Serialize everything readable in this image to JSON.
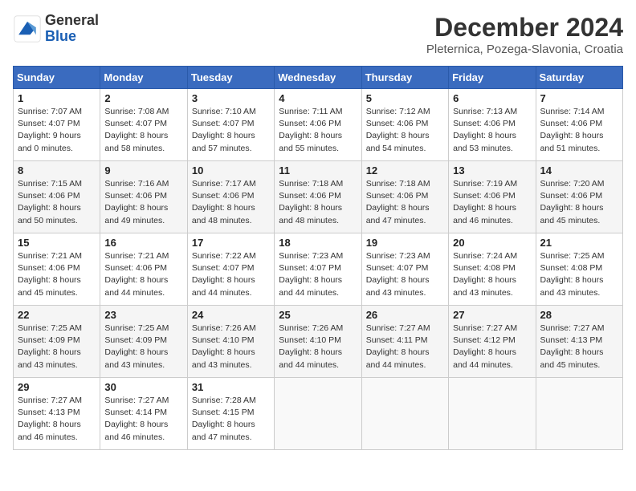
{
  "header": {
    "logo_general": "General",
    "logo_blue": "Blue",
    "title": "December 2024",
    "location": "Pleternica, Pozega-Slavonia, Croatia"
  },
  "days_of_week": [
    "Sunday",
    "Monday",
    "Tuesday",
    "Wednesday",
    "Thursday",
    "Friday",
    "Saturday"
  ],
  "weeks": [
    [
      {
        "day": 1,
        "sunrise": "Sunrise: 7:07 AM",
        "sunset": "Sunset: 4:07 PM",
        "daylight": "Daylight: 9 hours and 0 minutes."
      },
      {
        "day": 2,
        "sunrise": "Sunrise: 7:08 AM",
        "sunset": "Sunset: 4:07 PM",
        "daylight": "Daylight: 8 hours and 58 minutes."
      },
      {
        "day": 3,
        "sunrise": "Sunrise: 7:10 AM",
        "sunset": "Sunset: 4:07 PM",
        "daylight": "Daylight: 8 hours and 57 minutes."
      },
      {
        "day": 4,
        "sunrise": "Sunrise: 7:11 AM",
        "sunset": "Sunset: 4:06 PM",
        "daylight": "Daylight: 8 hours and 55 minutes."
      },
      {
        "day": 5,
        "sunrise": "Sunrise: 7:12 AM",
        "sunset": "Sunset: 4:06 PM",
        "daylight": "Daylight: 8 hours and 54 minutes."
      },
      {
        "day": 6,
        "sunrise": "Sunrise: 7:13 AM",
        "sunset": "Sunset: 4:06 PM",
        "daylight": "Daylight: 8 hours and 53 minutes."
      },
      {
        "day": 7,
        "sunrise": "Sunrise: 7:14 AM",
        "sunset": "Sunset: 4:06 PM",
        "daylight": "Daylight: 8 hours and 51 minutes."
      }
    ],
    [
      {
        "day": 8,
        "sunrise": "Sunrise: 7:15 AM",
        "sunset": "Sunset: 4:06 PM",
        "daylight": "Daylight: 8 hours and 50 minutes."
      },
      {
        "day": 9,
        "sunrise": "Sunrise: 7:16 AM",
        "sunset": "Sunset: 4:06 PM",
        "daylight": "Daylight: 8 hours and 49 minutes."
      },
      {
        "day": 10,
        "sunrise": "Sunrise: 7:17 AM",
        "sunset": "Sunset: 4:06 PM",
        "daylight": "Daylight: 8 hours and 48 minutes."
      },
      {
        "day": 11,
        "sunrise": "Sunrise: 7:18 AM",
        "sunset": "Sunset: 4:06 PM",
        "daylight": "Daylight: 8 hours and 48 minutes."
      },
      {
        "day": 12,
        "sunrise": "Sunrise: 7:18 AM",
        "sunset": "Sunset: 4:06 PM",
        "daylight": "Daylight: 8 hours and 47 minutes."
      },
      {
        "day": 13,
        "sunrise": "Sunrise: 7:19 AM",
        "sunset": "Sunset: 4:06 PM",
        "daylight": "Daylight: 8 hours and 46 minutes."
      },
      {
        "day": 14,
        "sunrise": "Sunrise: 7:20 AM",
        "sunset": "Sunset: 4:06 PM",
        "daylight": "Daylight: 8 hours and 45 minutes."
      }
    ],
    [
      {
        "day": 15,
        "sunrise": "Sunrise: 7:21 AM",
        "sunset": "Sunset: 4:06 PM",
        "daylight": "Daylight: 8 hours and 45 minutes."
      },
      {
        "day": 16,
        "sunrise": "Sunrise: 7:21 AM",
        "sunset": "Sunset: 4:06 PM",
        "daylight": "Daylight: 8 hours and 44 minutes."
      },
      {
        "day": 17,
        "sunrise": "Sunrise: 7:22 AM",
        "sunset": "Sunset: 4:07 PM",
        "daylight": "Daylight: 8 hours and 44 minutes."
      },
      {
        "day": 18,
        "sunrise": "Sunrise: 7:23 AM",
        "sunset": "Sunset: 4:07 PM",
        "daylight": "Daylight: 8 hours and 44 minutes."
      },
      {
        "day": 19,
        "sunrise": "Sunrise: 7:23 AM",
        "sunset": "Sunset: 4:07 PM",
        "daylight": "Daylight: 8 hours and 43 minutes."
      },
      {
        "day": 20,
        "sunrise": "Sunrise: 7:24 AM",
        "sunset": "Sunset: 4:08 PM",
        "daylight": "Daylight: 8 hours and 43 minutes."
      },
      {
        "day": 21,
        "sunrise": "Sunrise: 7:25 AM",
        "sunset": "Sunset: 4:08 PM",
        "daylight": "Daylight: 8 hours and 43 minutes."
      }
    ],
    [
      {
        "day": 22,
        "sunrise": "Sunrise: 7:25 AM",
        "sunset": "Sunset: 4:09 PM",
        "daylight": "Daylight: 8 hours and 43 minutes."
      },
      {
        "day": 23,
        "sunrise": "Sunrise: 7:25 AM",
        "sunset": "Sunset: 4:09 PM",
        "daylight": "Daylight: 8 hours and 43 minutes."
      },
      {
        "day": 24,
        "sunrise": "Sunrise: 7:26 AM",
        "sunset": "Sunset: 4:10 PM",
        "daylight": "Daylight: 8 hours and 43 minutes."
      },
      {
        "day": 25,
        "sunrise": "Sunrise: 7:26 AM",
        "sunset": "Sunset: 4:10 PM",
        "daylight": "Daylight: 8 hours and 44 minutes."
      },
      {
        "day": 26,
        "sunrise": "Sunrise: 7:27 AM",
        "sunset": "Sunset: 4:11 PM",
        "daylight": "Daylight: 8 hours and 44 minutes."
      },
      {
        "day": 27,
        "sunrise": "Sunrise: 7:27 AM",
        "sunset": "Sunset: 4:12 PM",
        "daylight": "Daylight: 8 hours and 44 minutes."
      },
      {
        "day": 28,
        "sunrise": "Sunrise: 7:27 AM",
        "sunset": "Sunset: 4:13 PM",
        "daylight": "Daylight: 8 hours and 45 minutes."
      }
    ],
    [
      {
        "day": 29,
        "sunrise": "Sunrise: 7:27 AM",
        "sunset": "Sunset: 4:13 PM",
        "daylight": "Daylight: 8 hours and 46 minutes."
      },
      {
        "day": 30,
        "sunrise": "Sunrise: 7:27 AM",
        "sunset": "Sunset: 4:14 PM",
        "daylight": "Daylight: 8 hours and 46 minutes."
      },
      {
        "day": 31,
        "sunrise": "Sunrise: 7:28 AM",
        "sunset": "Sunset: 4:15 PM",
        "daylight": "Daylight: 8 hours and 47 minutes."
      },
      null,
      null,
      null,
      null
    ]
  ]
}
